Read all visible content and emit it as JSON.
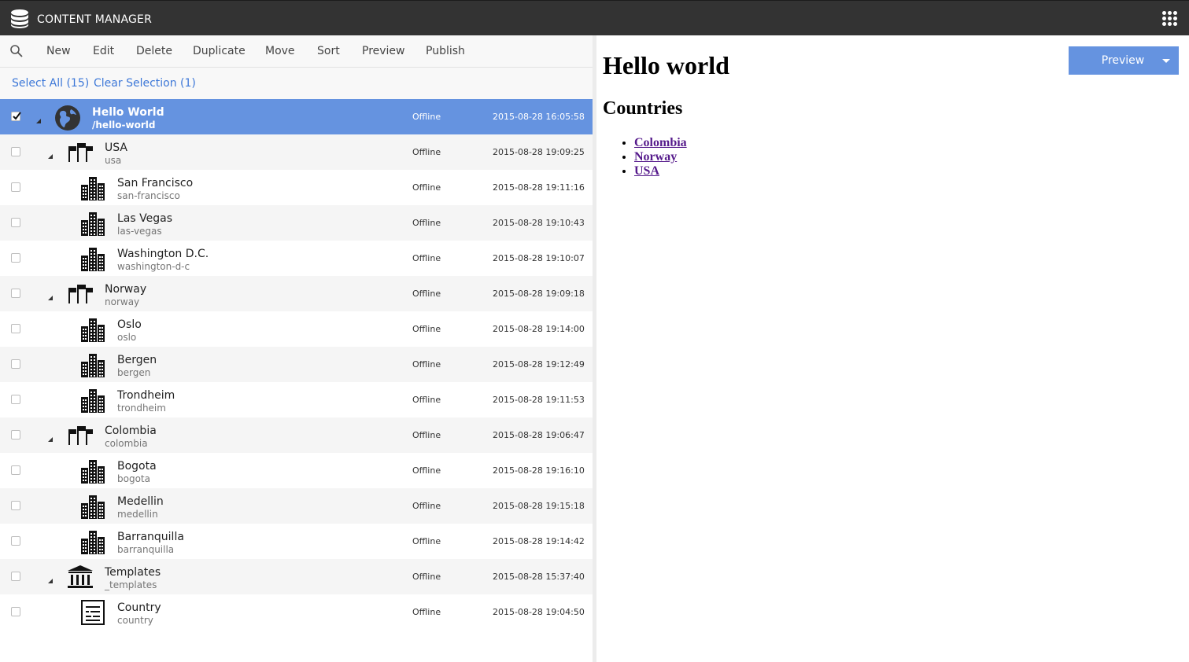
{
  "app": {
    "title": "CONTENT MANAGER",
    "logo_icon": "database-icon",
    "apps_icon": "apps-grid-icon",
    "bar_color": "#333333"
  },
  "toolbar": {
    "search_icon": "search-icon",
    "buttons": [
      "New",
      "Edit",
      "Delete",
      "Duplicate",
      "Move",
      "Sort",
      "Preview",
      "Publish"
    ]
  },
  "selection": {
    "select_all": "Select All (15)",
    "clear_selection": "Clear Selection (1)"
  },
  "rows": [
    {
      "name": "Hello World",
      "path": "/hello-world",
      "status": "Offline",
      "date": "2015-08-28 16:05:58",
      "icon": "globe-icon",
      "checked": true,
      "selected": true,
      "expandable": true
    },
    {
      "name": "USA",
      "path": "usa",
      "status": "Offline",
      "date": "2015-08-28 19:09:25",
      "icon": "flags-icon",
      "checked": false,
      "expandable": true
    },
    {
      "name": "San Francisco",
      "path": "san-francisco",
      "status": "Offline",
      "date": "2015-08-28 19:11:16",
      "icon": "city-icon",
      "checked": false
    },
    {
      "name": "Las Vegas",
      "path": "las-vegas",
      "status": "Offline",
      "date": "2015-08-28 19:10:43",
      "icon": "city-icon",
      "checked": false
    },
    {
      "name": "Washington D.C.",
      "path": "washington-d-c",
      "status": "Offline",
      "date": "2015-08-28 19:10:07",
      "icon": "city-icon",
      "checked": false
    },
    {
      "name": "Norway",
      "path": "norway",
      "status": "Offline",
      "date": "2015-08-28 19:09:18",
      "icon": "flags-icon",
      "checked": false,
      "expandable": true
    },
    {
      "name": "Oslo",
      "path": "oslo",
      "status": "Offline",
      "date": "2015-08-28 19:14:00",
      "icon": "city-icon",
      "checked": false
    },
    {
      "name": "Bergen",
      "path": "bergen",
      "status": "Offline",
      "date": "2015-08-28 19:12:49",
      "icon": "city-icon",
      "checked": false
    },
    {
      "name": "Trondheim",
      "path": "trondheim",
      "status": "Offline",
      "date": "2015-08-28 19:11:53",
      "icon": "city-icon",
      "checked": false
    },
    {
      "name": "Colombia",
      "path": "colombia",
      "status": "Offline",
      "date": "2015-08-28 19:06:47",
      "icon": "flags-icon",
      "checked": false,
      "expandable": true
    },
    {
      "name": "Bogota",
      "path": "bogota",
      "status": "Offline",
      "date": "2015-08-28 19:16:10",
      "icon": "city-icon",
      "checked": false
    },
    {
      "name": "Medellin",
      "path": "medellin",
      "status": "Offline",
      "date": "2015-08-28 19:15:18",
      "icon": "city-icon",
      "checked": false
    },
    {
      "name": "Barranquilla",
      "path": "barranquilla",
      "status": "Offline",
      "date": "2015-08-28 19:14:42",
      "icon": "city-icon",
      "checked": false
    },
    {
      "name": "Templates",
      "path": "_templates",
      "status": "Offline",
      "date": "2015-08-28 15:37:40",
      "icon": "templates-icon",
      "checked": false,
      "expandable": true
    },
    {
      "name": "Country",
      "path": "country",
      "status": "Offline",
      "date": "2015-08-28 19:04:50",
      "icon": "page-template-icon",
      "checked": false
    }
  ],
  "preview": {
    "button_label": "Preview",
    "dropdown_icon": "caret-down-icon",
    "heading": "Hello world",
    "subheading": "Countries",
    "countries": [
      "Colombia",
      "Norway",
      "USA"
    ]
  },
  "colors": {
    "accent": "#6593e0",
    "link": "#3d78d8",
    "visited_link": "#551a8b"
  }
}
